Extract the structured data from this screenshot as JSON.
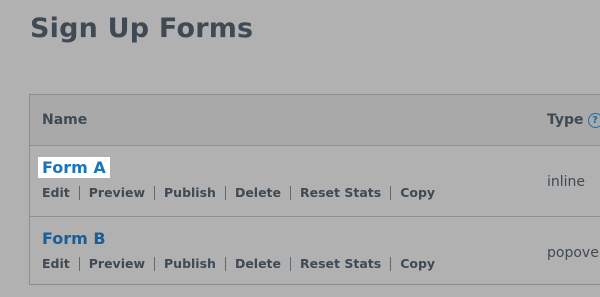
{
  "page": {
    "title": "Sign Up Forms"
  },
  "table": {
    "columns": {
      "name": "Name",
      "type": "Type"
    },
    "rows": [
      {
        "name": "Form A",
        "type": "inline",
        "actions": [
          "Edit",
          "Preview",
          "Publish",
          "Delete",
          "Reset Stats",
          "Copy"
        ]
      },
      {
        "name": "Form B",
        "type": "popove",
        "actions": [
          "Edit",
          "Preview",
          "Publish",
          "Delete",
          "Reset Stats",
          "Copy"
        ]
      }
    ]
  },
  "icons": {
    "type_help": "question-circle-icon"
  }
}
